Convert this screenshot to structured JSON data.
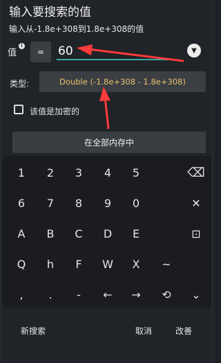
{
  "dialog": {
    "title": "输入要搜索的值",
    "subtitle": "输入从-1.8e+308到1.8e+308的值"
  },
  "value_row": {
    "label": "值",
    "info_icon": "i",
    "operator": "=",
    "value": "60"
  },
  "type_row": {
    "label": "类型:",
    "selected": "Double (-1.8e+308 - 1.8e+308)"
  },
  "encrypted": {
    "label": "该值是加密的",
    "checked": false
  },
  "scope_button": "在全部内存中",
  "keyboard": {
    "rows": [
      [
        "1",
        "2",
        "3",
        "4",
        "5",
        "⌫"
      ],
      [
        "6",
        "7",
        "8",
        "9",
        "0",
        "✕"
      ],
      [
        "A",
        "B",
        "C",
        "D",
        "E",
        "⊡"
      ],
      [
        "Q",
        "h",
        "F",
        "W",
        "X",
        "~"
      ],
      [
        ",",
        ".",
        "-",
        "←",
        "→",
        "⟲",
        "⌄"
      ]
    ]
  },
  "actions": {
    "new_search": "新搜索",
    "cancel": "取消",
    "modify": "改善"
  },
  "colors": {
    "accent": "#3aa9a0",
    "type_text": "#e6c26b",
    "arrow": "#ff3b3b"
  }
}
